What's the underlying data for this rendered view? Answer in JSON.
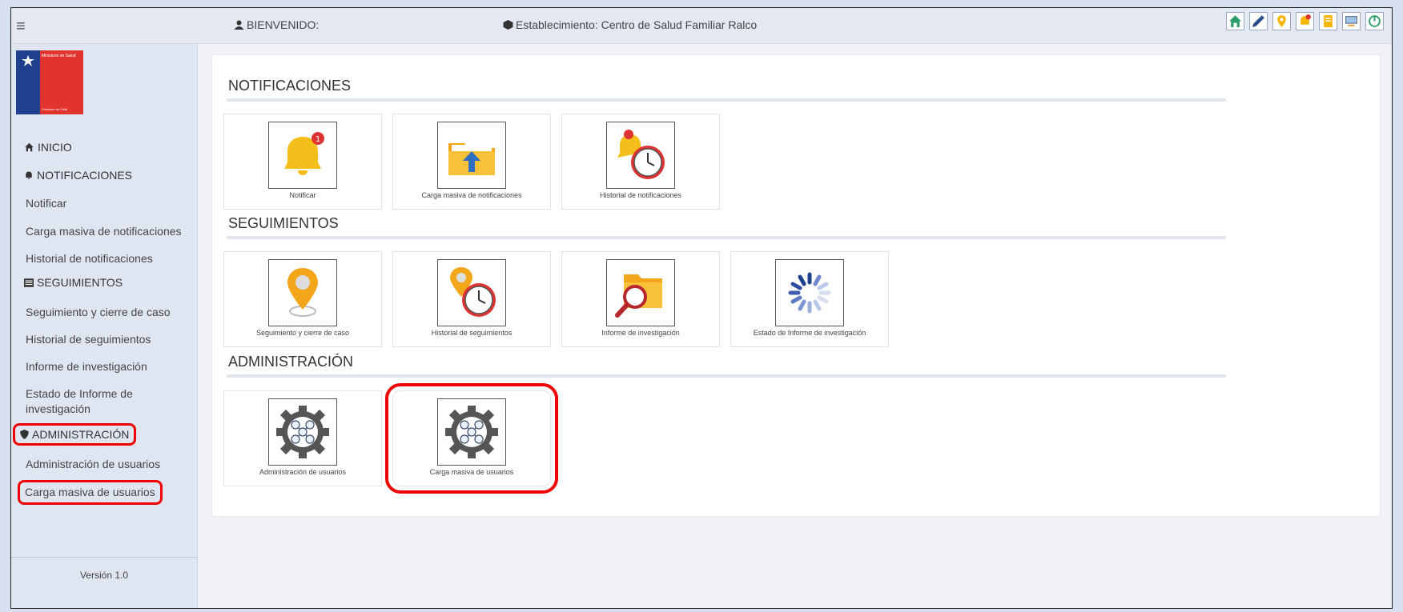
{
  "topbar": {
    "welcome": "BIENVENIDO:",
    "establishment": "Establecimiento: Centro de Salud Familiar Ralco",
    "icons": [
      "home-icon",
      "pencil-icon",
      "location-pin-icon",
      "notification-icon",
      "document-icon",
      "computer-icon",
      "power-icon"
    ]
  },
  "sidebar": {
    "logo": {
      "ministry": "Ministerio de Salud",
      "gov": "Gobierno de Chile"
    },
    "inicio": "INICIO",
    "notificaciones": "NOTIFICACIONES",
    "notificar": "Notificar",
    "carga_notificaciones": "Carga masiva de notificaciones",
    "historial_notificaciones": "Historial de notificaciones",
    "seguimientos": "SEGUIMIENTOS",
    "seguimiento_cierre": "Seguimiento y cierre de caso",
    "historial_seguimientos": "Historial de seguimientos",
    "informe": "Informe de investigación",
    "estado_informe": "Estado de Informe de investigación",
    "administracion": "ADMINISTRACIÓN",
    "admin_usuarios": "Administración de usuarios",
    "carga_usuarios": "Carga masiva de usuarios",
    "version": "Versión 1.0"
  },
  "main": {
    "sections": {
      "notificaciones": "NOTIFICACIONES",
      "seguimientos": "SEGUIMIENTOS",
      "administracion": "ADMINISTRACIÓN"
    },
    "tiles": {
      "notificar": "Notificar",
      "carga_notificaciones": "Carga masiva de notificaciones",
      "historial_notificaciones": "Historial de notificaciones",
      "seguimiento_cierre": "Seguimiento y cierre de caso",
      "historial_seguimientos": "Historial de seguimientos",
      "informe": "Informe de investigación",
      "estado_informe": "Estado de Informe de investigación",
      "admin_usuarios": "Administración de usuarios",
      "carga_usuarios": "Carga masiva de usuarios"
    }
  }
}
